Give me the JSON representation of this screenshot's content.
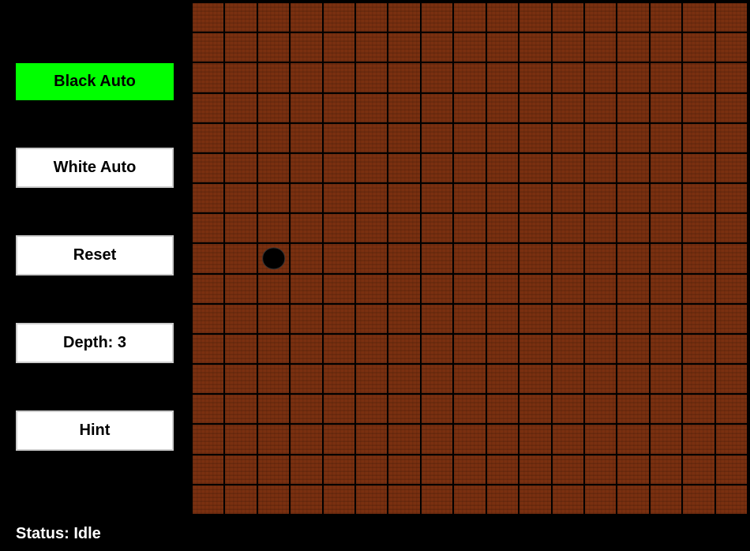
{
  "sidebar": {
    "black_auto_label": "Black Auto",
    "white_auto_label": "White Auto",
    "reset_label": "Reset",
    "depth_label": "Depth: 3",
    "hint_label": "Hint",
    "status_label": "Status: Idle"
  },
  "board": {
    "cols": 17,
    "rows": 17,
    "black_stone_col": 2,
    "black_stone_row": 8
  },
  "colors": {
    "black_auto_bg": "#00ff00",
    "cell_bg": "#7a3010",
    "board_gap": "#000"
  }
}
